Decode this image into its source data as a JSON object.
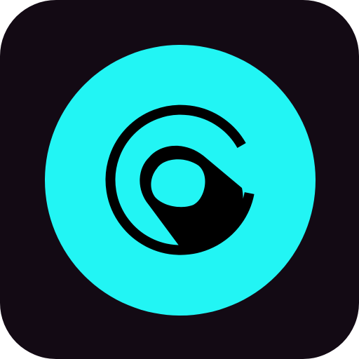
{
  "app_icon": {
    "icon_name": "app-logo-icon",
    "colors": {
      "background": "#130a14",
      "accent": "#22f5f4",
      "glyph": "#000000"
    }
  }
}
